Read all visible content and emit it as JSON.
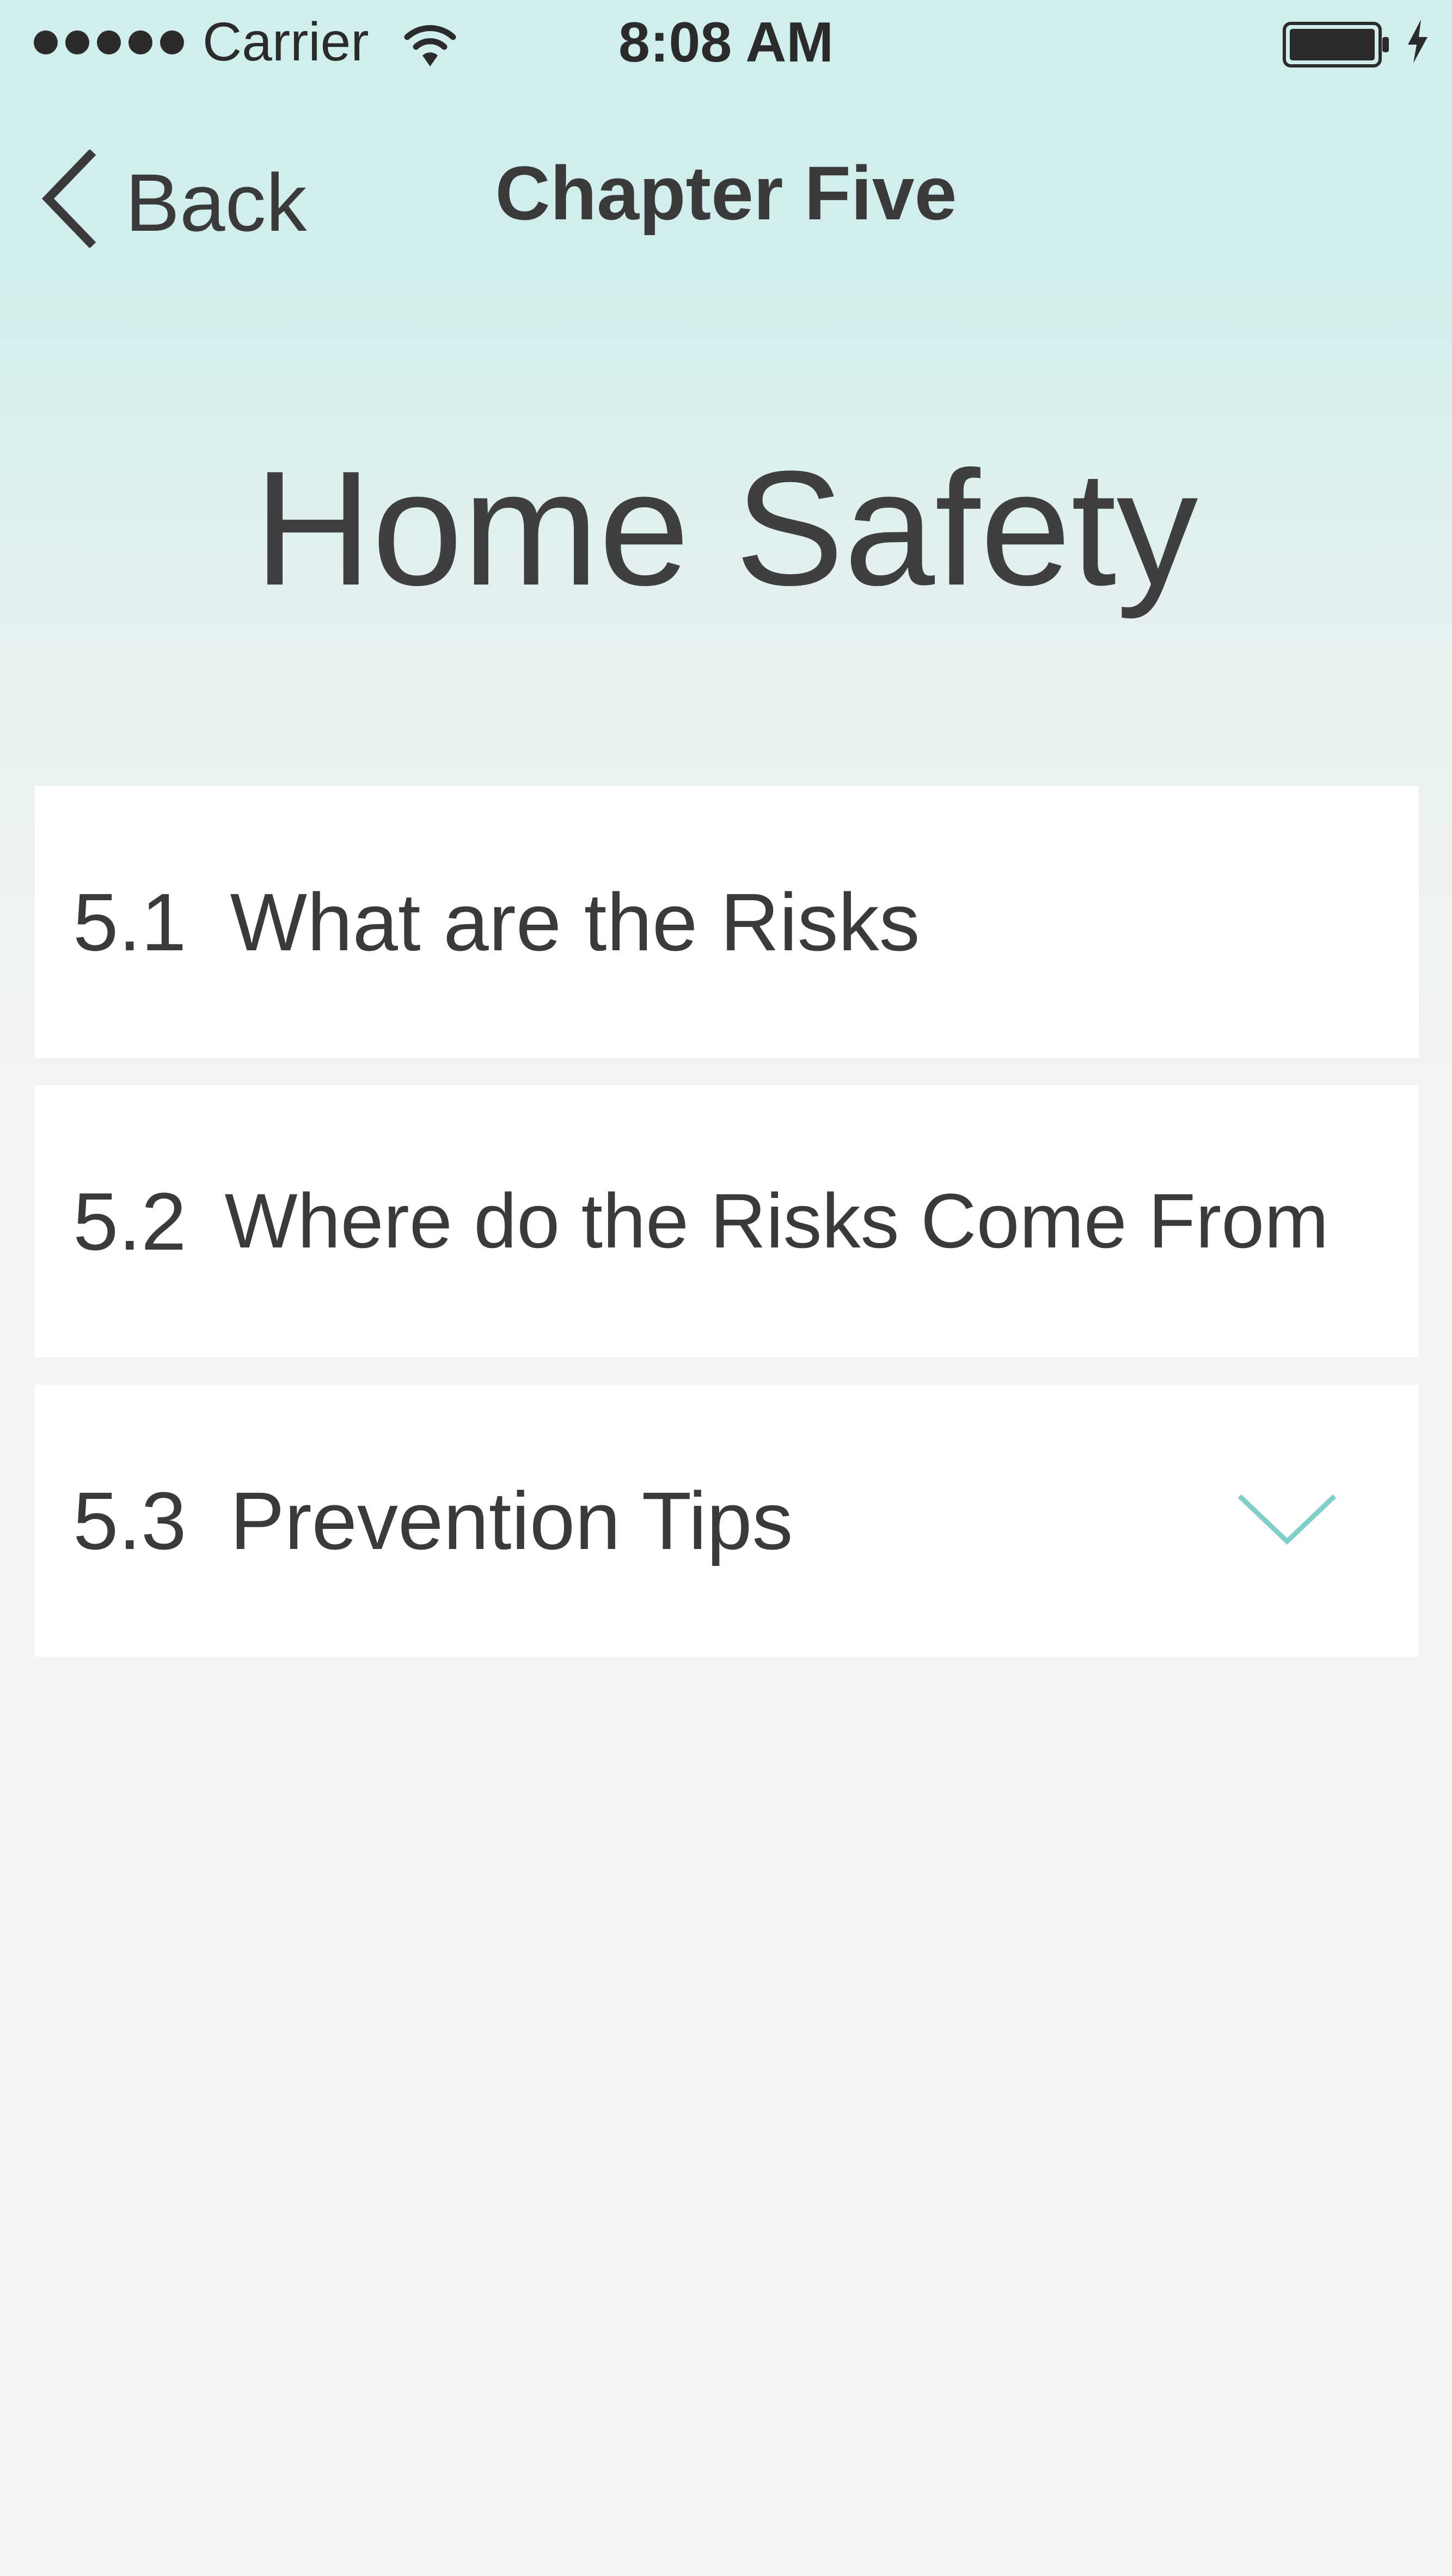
{
  "status_bar": {
    "carrier": "Carrier",
    "time": "8:08 AM",
    "signal_icon": "signal-dots-icon",
    "wifi_icon": "wifi-icon",
    "battery_icon": "battery-icon",
    "charging_icon": "charging-bolt-icon"
  },
  "nav": {
    "back_label": "Back",
    "title": "Chapter Five"
  },
  "page": {
    "title": "Home Safety"
  },
  "sections": [
    {
      "number": "5.1",
      "title": "What are the Risks"
    },
    {
      "number": "5.2",
      "title": "Where do the Risks Come From"
    },
    {
      "number": "5.3",
      "title": "Prevention Tips",
      "expand_icon": "chevron-down-icon"
    }
  ],
  "colors": {
    "accent": "#7fcfc8",
    "header_tint": "#d0eeec",
    "background": "#f3f3f3",
    "text": "#3a3a3a"
  }
}
